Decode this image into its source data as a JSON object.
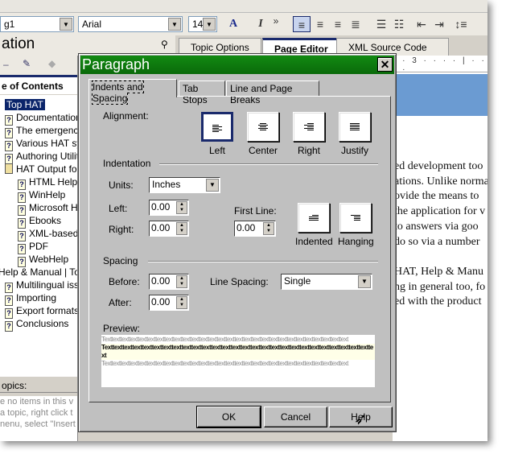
{
  "toolbar": {
    "style_value": "g1",
    "font_value": "Arial",
    "size_value": "14",
    "font_color_label": "A",
    "italic_label": "I",
    "more_label": "»"
  },
  "panel": {
    "title": "ation",
    "pin_icon": "pin-icon",
    "toc_tab": "e of Contents",
    "topics_label": "opics:",
    "topics_text": [
      "e no items in this v",
      "a topic, right click t",
      "nenu, select \"Insert"
    ]
  },
  "editor_tabs": [
    {
      "label": "Topic Options"
    },
    {
      "label": "Page Editor",
      "active": true
    },
    {
      "label": "XML Source Code"
    }
  ],
  "tree": [
    {
      "label": "Top HAT",
      "level": 0,
      "selected": true,
      "icon": "none"
    },
    {
      "label": "Documentation",
      "level": 0,
      "icon": "help-topic-icon"
    },
    {
      "label": "The emergence",
      "level": 0,
      "icon": "help-topic-icon"
    },
    {
      "label": "Various HAT sy",
      "level": 0,
      "icon": "help-topic-icon"
    },
    {
      "label": "Authoring Utilitie",
      "level": 0,
      "icon": "help-topic-icon"
    },
    {
      "label": "HAT Output for",
      "level": 0,
      "icon": "book-open-icon"
    },
    {
      "label": "HTML Help",
      "level": 1,
      "icon": "help-topic-icon"
    },
    {
      "label": "WinHelp",
      "level": 1,
      "icon": "help-topic-icon"
    },
    {
      "label": "Microsoft He",
      "level": 1,
      "icon": "help-topic-icon"
    },
    {
      "label": "Ebooks",
      "level": 1,
      "icon": "help-topic-icon"
    },
    {
      "label": "XML-based",
      "level": 1,
      "icon": "help-topic-icon"
    },
    {
      "label": "PDF",
      "level": 1,
      "icon": "help-topic-icon"
    },
    {
      "label": "WebHelp",
      "level": 1,
      "icon": "help-topic-icon"
    },
    {
      "label": "Help & Manual | To",
      "level": -1,
      "icon": "none"
    },
    {
      "label": "Multilingual issu",
      "level": 0,
      "icon": "help-topic-icon"
    },
    {
      "label": "Importing",
      "level": 0,
      "icon": "help-topic-icon"
    },
    {
      "label": "Export formats",
      "level": 0,
      "icon": "help-topic-icon"
    },
    {
      "label": "Conclusions",
      "level": 0,
      "icon": "help-topic-icon"
    }
  ],
  "ruler": {
    "label": "· · 3 · · · · | · · · ·"
  },
  "editor_text": [
    "ed development too",
    "ations. Unlike norma",
    "ovide the means to",
    "the application for v",
    "to answers via goo",
    "do so via a number",
    "",
    "HAT, Help & Manu",
    "ng in general too, fo",
    "ed with the product"
  ],
  "dialog": {
    "title": "Paragraph",
    "close_label": "✕",
    "tabs": [
      "Indents and Spacing",
      "Tab Stops",
      "Line and Page Breaks"
    ],
    "alignment_label": "Alignment:",
    "alignments": [
      {
        "label": "Left",
        "selected": true
      },
      {
        "label": "Center"
      },
      {
        "label": "Right"
      },
      {
        "label": "Justify"
      }
    ],
    "indentation_label": "Indentation",
    "units_label": "Units:",
    "units_value": "Inches",
    "left_label": "Left:",
    "left_value": "0.00",
    "right_label": "Right:",
    "right_value": "0.00",
    "first_line_label": "First Line:",
    "first_line_value": "0.00",
    "first_line_modes": [
      {
        "label": "Indented"
      },
      {
        "label": "Hanging"
      }
    ],
    "spacing_label": "Spacing",
    "before_label": "Before:",
    "before_value": "0.00",
    "after_label": "After:",
    "after_value": "0.00",
    "line_spacing_label": "Line Spacing:",
    "line_spacing_value": "Single",
    "preview_label": "Preview:",
    "preview_lines": [
      "Texttexttexttexttexttexttexttexttexttexttexttexttexttexttexttexttexttexttexttexttexttexttexttexttexttexttexttext",
      "Texttexttexttexttexttexttexttexttexttexttexttexttexttexttexttexttexttexttexttexttexttexttexttexttexttexttexttext",
      "Texttexttexttexttexttexttexttexttexttexttexttexttexttexttexttexttexttexttexttexttexttexttexttexttexttexttexttext"
    ],
    "buttons": {
      "ok": "OK",
      "cancel": "Cancel",
      "help": "Help"
    }
  },
  "colors": {
    "title_bar": "#0a7a0a",
    "selection": "#0a246a",
    "editor_header": "#6b9bd2"
  }
}
